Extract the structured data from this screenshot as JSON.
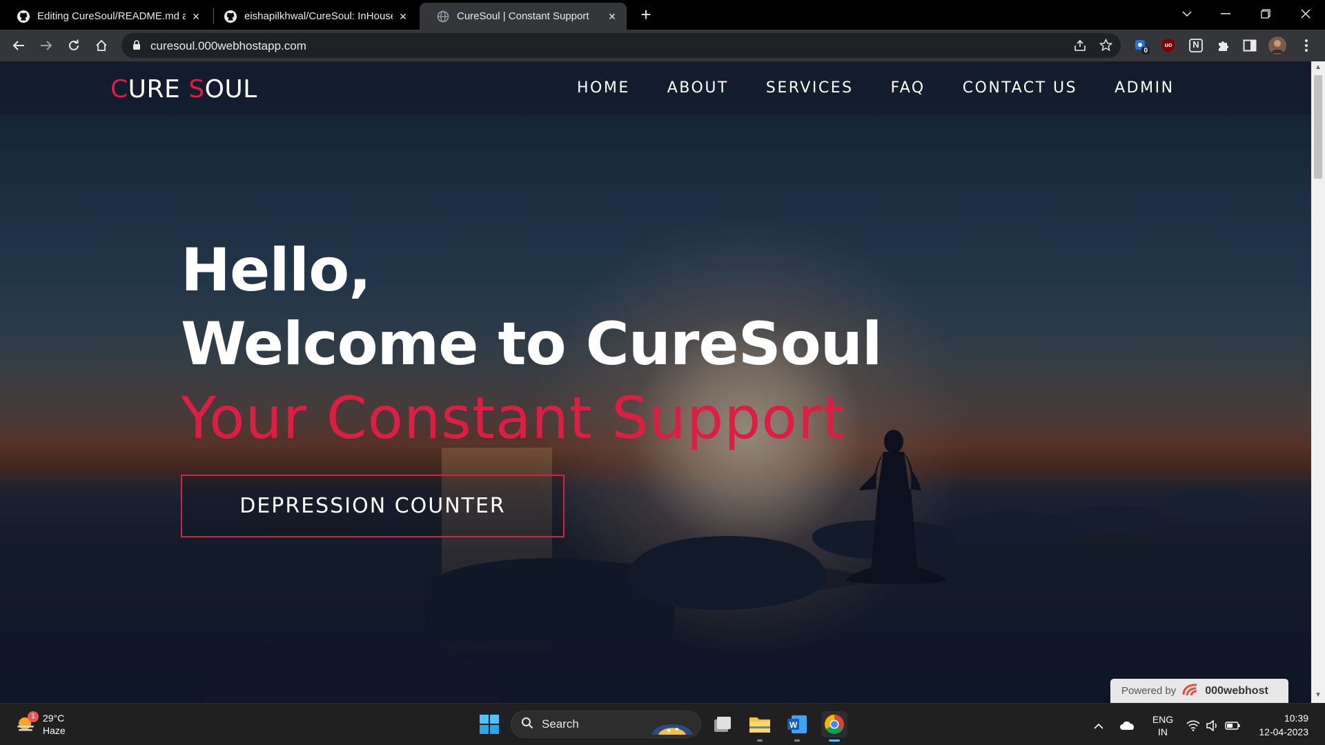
{
  "browser": {
    "tabs": [
      {
        "title": "Editing CureSoul/README.md at",
        "favicon": "github-icon",
        "active": false
      },
      {
        "title": "eishapilkhwal/CureSoul: InHouse",
        "favicon": "github-icon",
        "active": false
      },
      {
        "title": "CureSoul | Constant Support",
        "favicon": "globe-icon",
        "active": true
      }
    ],
    "new_tab": "+",
    "url": "curesoul.000webhostapp.com",
    "extension_badge": "0",
    "extension_ub_label": "uo",
    "extension_n_label": "N"
  },
  "site": {
    "logo": {
      "c": "C",
      "ure": "URE ",
      "s": "S",
      "oul": "OUL"
    },
    "nav": [
      "HOME",
      "ABOUT",
      "SERVICES",
      "FAQ",
      "CONTACT US",
      "ADMIN"
    ],
    "hero": {
      "line1": "Hello,",
      "line2": "Welcome to CureSoul",
      "tagline": "Your Constant Support",
      "cta": "DEPRESSION COUNTER"
    },
    "powered": {
      "prefix": "Powered by",
      "brand": "000webhost"
    },
    "colors": {
      "accent": "#dc1e42",
      "text": "#ffffff"
    }
  },
  "taskbar": {
    "weather": {
      "temp": "29°C",
      "condition": "Haze",
      "badge": "1"
    },
    "search_label": "Search",
    "tray": {
      "lang": "ENG",
      "region": "IN"
    },
    "clock": {
      "time": "10:39",
      "date": "12-04-2023"
    }
  }
}
